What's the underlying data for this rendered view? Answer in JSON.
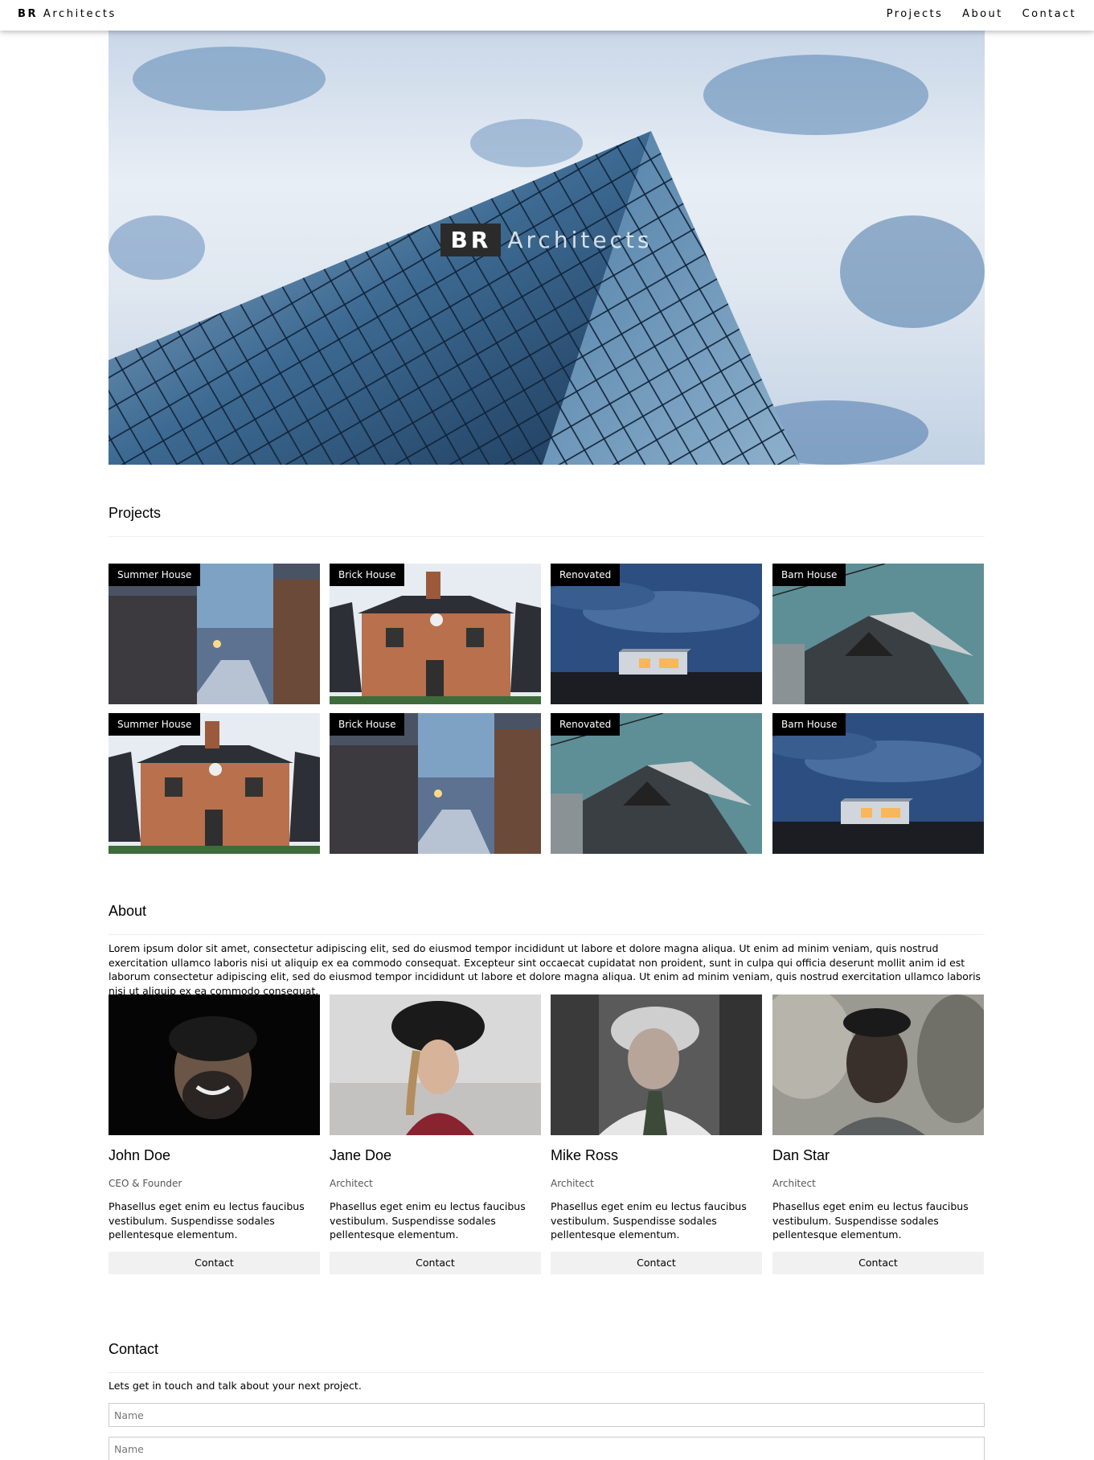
{
  "nav": {
    "brand_bold": "BR",
    "brand_rest": "Architects",
    "links": [
      "Projects",
      "About",
      "Contact"
    ]
  },
  "hero": {
    "title_bold": "BR",
    "title_rest": "Architects"
  },
  "projects": {
    "heading": "Projects",
    "items": [
      {
        "label": "Summer House"
      },
      {
        "label": "Brick House"
      },
      {
        "label": "Renovated"
      },
      {
        "label": "Barn House"
      },
      {
        "label": "Summer House"
      },
      {
        "label": "Brick House"
      },
      {
        "label": "Renovated"
      },
      {
        "label": "Barn House"
      }
    ]
  },
  "about": {
    "heading": "About",
    "text": "Lorem ipsum dolor sit amet, consectetur adipiscing elit, sed do eiusmod tempor incididunt ut labore et dolore magna aliqua. Ut enim ad minim veniam, quis nostrud exercitation ullamco laboris nisi ut aliquip ex ea commodo consequat. Excepteur sint occaecat cupidatat non proident, sunt in culpa qui officia deserunt mollit anim id est laborum consectetur adipiscing elit, sed do eiusmod tempor incididunt ut labore et dolore magna aliqua. Ut enim ad minim veniam, quis nostrud exercitation ullamco laboris nisi ut aliquip ex ea commodo consequat.",
    "team": [
      {
        "name": "John Doe",
        "role": "CEO & Founder",
        "bio": "Phasellus eget enim eu lectus faucibus vestibulum. Suspendisse sodales pellentesque elementum.",
        "button": "Contact"
      },
      {
        "name": "Jane Doe",
        "role": "Architect",
        "bio": "Phasellus eget enim eu lectus faucibus vestibulum. Suspendisse sodales pellentesque elementum.",
        "button": "Contact"
      },
      {
        "name": "Mike Ross",
        "role": "Architect",
        "bio": "Phasellus eget enim eu lectus faucibus vestibulum. Suspendisse sodales pellentesque elementum.",
        "button": "Contact"
      },
      {
        "name": "Dan Star",
        "role": "Architect",
        "bio": "Phasellus eget enim eu lectus faucibus vestibulum. Suspendisse sodales pellentesque elementum.",
        "button": "Contact"
      }
    ]
  },
  "contact": {
    "heading": "Contact",
    "intro": "Lets get in touch and talk about your next project.",
    "fields": [
      {
        "placeholder": "Name"
      },
      {
        "placeholder": "Name"
      }
    ]
  }
}
